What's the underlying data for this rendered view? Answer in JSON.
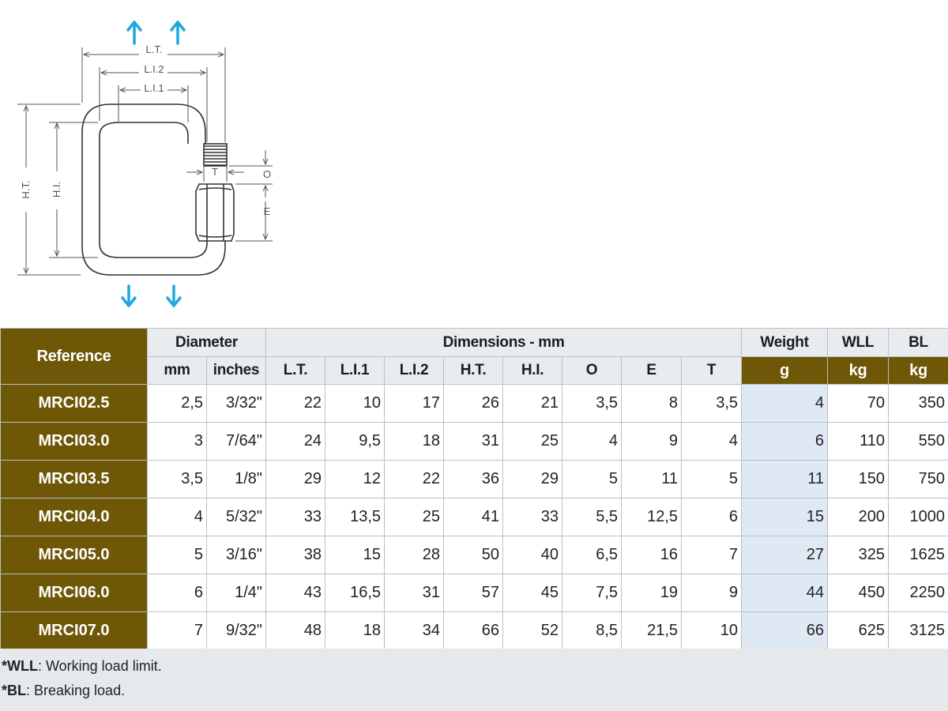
{
  "diagram": {
    "labels": {
      "lt": "L.T.",
      "li2": "L.I.2",
      "li1": "L.I.1",
      "ht": "H.T.",
      "hi": "H.I.",
      "t": "T",
      "o": "O",
      "e": "E"
    },
    "arrow_color": "#1ea7dd"
  },
  "table": {
    "reference_header": "Reference",
    "diameter_header": "Diameter",
    "dimensions_header": "Dimensions - mm",
    "weight_header": "Weight",
    "wll_header": "WLL",
    "bl_header": "BL",
    "sub_headers": [
      "mm",
      "inches",
      "L.T.",
      "L.I.1",
      "L.I.2",
      "H.T.",
      "H.I.",
      "O",
      "E",
      "T",
      "g",
      "kg",
      "kg"
    ],
    "rows": [
      [
        "MRCI02.5",
        "2,5",
        "3/32\"",
        "22",
        "10",
        "17",
        "26",
        "21",
        "3,5",
        "8",
        "3,5",
        "4",
        "70",
        "350"
      ],
      [
        "MRCI03.0",
        "3",
        "7/64\"",
        "24",
        "9,5",
        "18",
        "31",
        "25",
        "4",
        "9",
        "4",
        "6",
        "110",
        "550"
      ],
      [
        "MRCI03.5",
        "3,5",
        "1/8\"",
        "29",
        "12",
        "22",
        "36",
        "29",
        "5",
        "11",
        "5",
        "11",
        "150",
        "750"
      ],
      [
        "MRCI04.0",
        "4",
        "5/32\"",
        "33",
        "13,5",
        "25",
        "41",
        "33",
        "5,5",
        "12,5",
        "6",
        "15",
        "200",
        "1000"
      ],
      [
        "MRCI05.0",
        "5",
        "3/16\"",
        "38",
        "15",
        "28",
        "50",
        "40",
        "6,5",
        "16",
        "7",
        "27",
        "325",
        "1625"
      ],
      [
        "MRCI06.0",
        "6",
        "1/4\"",
        "43",
        "16,5",
        "31",
        "57",
        "45",
        "7,5",
        "19",
        "9",
        "44",
        "450",
        "2250"
      ],
      [
        "MRCI07.0",
        "7",
        "9/32\"",
        "48",
        "18",
        "34",
        "66",
        "52",
        "8,5",
        "21,5",
        "10",
        "66",
        "625",
        "3125"
      ]
    ]
  },
  "footnotes": {
    "wll_term": "*WLL",
    "wll_text": ": Working load limit.",
    "bl_term": "*BL",
    "bl_text": ": Breaking load."
  },
  "colors": {
    "header_gold": "#6e5707",
    "weight_column": "#dfe9f3",
    "header_gray": "#e9ecef",
    "footer_gray": "#e6e9ec"
  }
}
